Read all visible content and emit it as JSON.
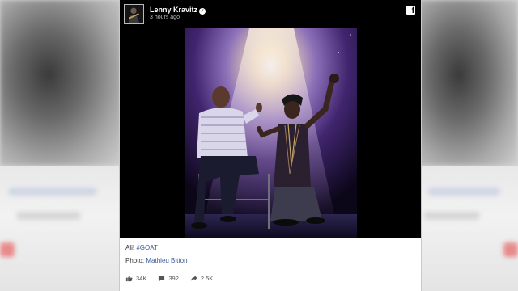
{
  "post": {
    "author": "Lenny Kravitz",
    "verified_mark": "✓",
    "timestamp": "3 hours ago",
    "facebook_glyph": "f",
    "caption_text": "Ali!",
    "caption_hashtag": "#GOAT",
    "credit_label": "Photo:",
    "credit_name": "Mathieu Bitton"
  },
  "stats": {
    "likes": "34K",
    "comments": "392",
    "shares": "2.5K"
  },
  "colors": {
    "link": "#3b5998",
    "header": "#000000"
  }
}
